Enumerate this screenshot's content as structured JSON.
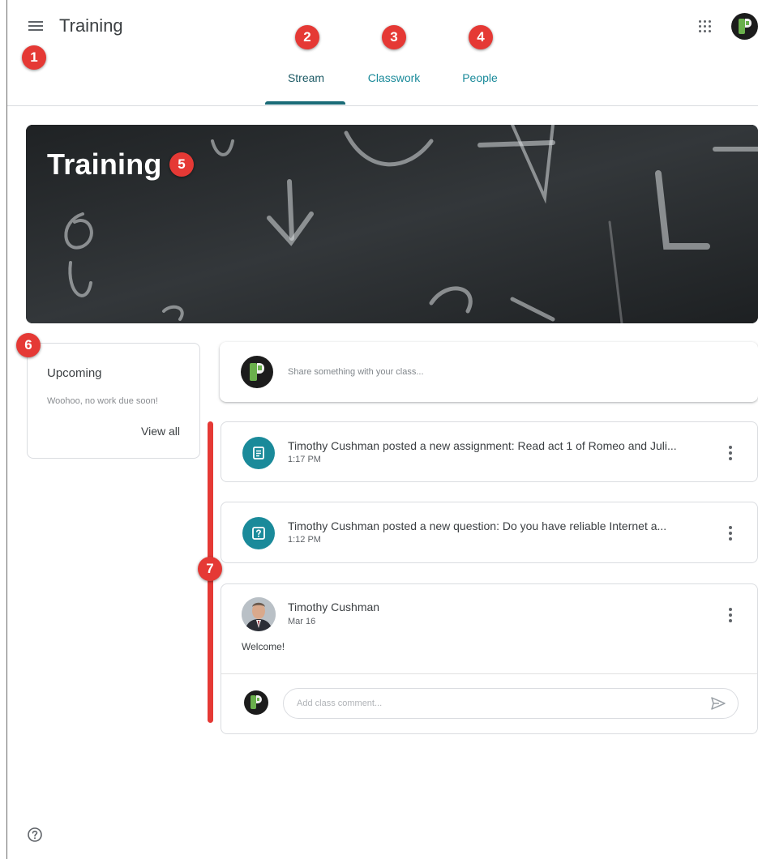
{
  "header": {
    "title": "Training",
    "tabs": [
      {
        "label": "Stream",
        "active": true
      },
      {
        "label": "Classwork",
        "active": false
      },
      {
        "label": "People",
        "active": false
      }
    ]
  },
  "icons": {
    "menu": "hamburger-menu-icon",
    "apps": "google-apps-grid-icon",
    "help": "help-icon",
    "assignment": "assignment-icon",
    "question": "question-icon",
    "send": "send-icon",
    "more": "more-vert-icon"
  },
  "callouts": [
    "1",
    "2",
    "3",
    "4",
    "5",
    "6",
    "7"
  ],
  "banner": {
    "title": "Training"
  },
  "upcoming": {
    "title": "Upcoming",
    "message": "Woohoo, no work due soon!",
    "view_all": "View all"
  },
  "share": {
    "placeholder": "Share something with your class..."
  },
  "posts": [
    {
      "title": "Timothy Cushman posted a new assignment: Read act 1 of Romeo and Juli...",
      "time": "1:17 PM",
      "type": "assignment"
    },
    {
      "title": "Timothy Cushman posted a new question: Do you have reliable Internet a...",
      "time": "1:12 PM",
      "type": "question"
    }
  ],
  "announcement": {
    "author": "Timothy Cushman",
    "date": "Mar 16",
    "body": "Welcome!",
    "comment_placeholder": "Add class comment..."
  },
  "colors": {
    "accent": "#1a8a9a",
    "tab_active": "#1e5b66",
    "callout": "#e53935",
    "banner_bg": "#2a2d30"
  }
}
